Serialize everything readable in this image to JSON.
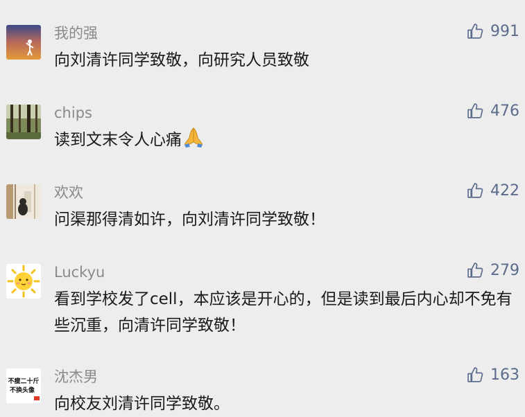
{
  "comments": [
    {
      "name": "我的强",
      "likes": "991",
      "text": "向刘清许同学致敬，向研究人员致敬",
      "avatar_icon": "sunset-figure-avatar"
    },
    {
      "name": "chips",
      "likes": "476",
      "text": "读到文末令人心痛",
      "emoji": "folded-hands-emoji",
      "avatar_icon": "forest-avatar"
    },
    {
      "name": "欢欢",
      "likes": "422",
      "text": "问渠那得清如许，向刘清许同学致敬！",
      "avatar_icon": "cat-window-avatar"
    },
    {
      "name": "Luckyu",
      "likes": "279",
      "text": "看到学校发了cell，本应该是开心的，但是读到最后内心却不免有些沉重，向清许同学致敬！",
      "avatar_icon": "sun-face-avatar"
    },
    {
      "name": "沈杰男",
      "likes": "163",
      "text": "向校友刘清许同学致敬。",
      "avatar_icon": "text-avatar",
      "avatar_text": [
        "不瘦二十斤",
        "不换头像"
      ]
    }
  ],
  "colors": {
    "background": "#ededed",
    "name": "#8a8a8a",
    "text": "#1a1a1a",
    "like": "#5a6b8c"
  },
  "icons": {
    "like": "thumbs-up-icon"
  }
}
